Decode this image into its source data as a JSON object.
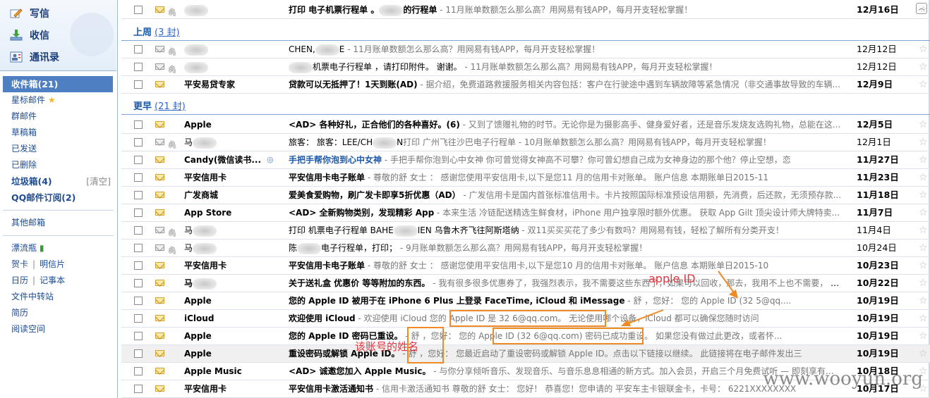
{
  "sidebar": {
    "actions": [
      {
        "label": "写信",
        "icon": "pencil-icon"
      },
      {
        "label": "收信",
        "icon": "inbox-download-icon"
      },
      {
        "label": "通讯录",
        "icon": "address-book-icon"
      }
    ],
    "inbox": "收件箱(21)",
    "starred": "星标邮件",
    "group_mail": "群邮件",
    "drafts": "草稿箱",
    "sent": "已发送",
    "deleted": "已删除",
    "junk": "垃圾箱(4)",
    "junk_clear": "[清空]",
    "subscriptions": "QQ邮件订阅(2)",
    "other": "其他邮箱",
    "drift_bottle": "漂流瓶",
    "cards": "贺卡",
    "postcards": "明信片",
    "calendar": "日历",
    "notes": "记事本",
    "file_transfer": "文件中转站",
    "resume": "简历",
    "reading": "阅读空间"
  },
  "groups": {
    "last_week": {
      "label": "上周",
      "count": "(3 封)"
    },
    "earlier": {
      "label": "更早",
      "count": "(21 封)"
    }
  },
  "emails": [
    {
      "sender": "",
      "title": "打印 电子机票行程单  。",
      "title2": "的行程单",
      "preview": " - 11月账单数额怎么那么高？用网易有钱APP，每月开支轻松掌握！",
      "date": "12月16日",
      "unread": true
    },
    {
      "sender": "",
      "title": "CHEN,",
      "title2": "E",
      "preview": " - 11月账单数额怎么那么高？用网易有钱APP，每月开支轻松掌握！",
      "date": "12月12日",
      "unread": false
    },
    {
      "sender": "",
      "title": "",
      "title2": "机票电子行程单   ，请打印附件。 谢谢。",
      "preview": " - 11月账单数额怎么那么高？用网易有钱APP，每月开支轻松掌握！",
      "date": "12月12日",
      "unread": false
    },
    {
      "sender": "平安易贷专家",
      "title": "贷款可以无抵押了！1天到账(AD)",
      "title2": "",
      "preview": " - 据介绍，免费道路救援服务相关内容包括：客户在行驶途中遇到车辆故障等紧急情况（非交通事故导致的车辆...",
      "date": "12月9日",
      "unread": true
    },
    {
      "sender": "Apple",
      "title": "<AD> 各种好礼，正合他们的各种喜好。(6)",
      "title2": "",
      "preview": " - 又到了馈赠礼物的时节。无论你是为摄影高手、健身爱好者，还是音乐发烧友选购礼物，总能在这...",
      "date": "12月5日",
      "unread": true
    },
    {
      "sender": "马",
      "title": "旅客：  旅客：LEE/CH",
      "title2": "N",
      "preview": "打印 广州飞往沙巴电子行程单 - 10月账单数额怎么那么高？用网易有钱APP，每月开支轻松掌握！",
      "date": "12月1日",
      "unread": false
    },
    {
      "sender": "Candy(微信读书...",
      "title": "手把手帮你泡到心中女神",
      "title2": "",
      "preview": " - 手把手帮你泡到心中女神 你可曾觉得女神高不可攀？你可曾幻想自己成为女神身边的那个他？停止空想，恋",
      "date": "11月27日",
      "unread": true
    },
    {
      "sender": "平安信用卡",
      "title": "平安信用卡电子账单",
      "title2": "",
      "preview": " - 尊敬的舒   女士 ： 感谢您使用平安信用卡,以下是您11 月的信用卡对账单。 账户信息 本期账单日2015-11",
      "date": "11月23日",
      "unread": true
    },
    {
      "sender": "广发商城",
      "title": "爱美食爱购物，刷广发卡即享5折优惠（AD）",
      "title2": "",
      "preview": " - 广发信用卡是国内首张标准信用卡。卡片按照国际标准预设信用额，先消费，后还款，无须预存款...",
      "date": "11月18日",
      "unread": true
    },
    {
      "sender": "App Store",
      "title": "<AD> 全新购物类别，发现精彩 App",
      "title2": "",
      "preview": " - 本来生活 冷链配送精选生鲜食材，iPhone 用户独享限时额外优惠。 获取 App Gilt 顶尖设计师大牌特卖...",
      "date": "11月7日",
      "unread": true
    },
    {
      "sender": "马",
      "title": "打印 机票电子行程单     BAHE",
      "title2": "IEN 乌鲁木齐飞往阿斯塔纳",
      "preview": " - 双11买买买花了多少有数吗？用网易有钱，轻松了解所有分类开支！",
      "date": "11月4日",
      "unread": false
    },
    {
      "sender": "马",
      "title": "陈",
      "title2": "电子行程单，打印；",
      "preview": " - 9月账单数额怎么那么高？用网易有钱APP，每月开支轻松掌握！",
      "date": "10月24日",
      "unread": false
    },
    {
      "sender": "平安信用卡",
      "title": "平安信用卡电子账单",
      "title2": "",
      "preview": " - 尊敬的舒   女士 ： 感谢您使用平安信用卡,以下是您10 月的信用卡对账单。 账户信息 本期账单日2015-10",
      "date": "10月23日",
      "unread": true
    },
    {
      "sender": "马",
      "title": "关于送礼盒 优惠价 等等附加的东西。",
      "title2": "",
      "preview": " - 我有很多很多优惠券了，我强烈表示，我不需要这些东西了，如果可以回收，那去，我用不上也不需要， 拿...",
      "date": "10月22日",
      "unread": true
    },
    {
      "sender": "Apple",
      "title": "您的 Apple ID 被用于在 iPhone 6 Plus 上登录 FaceTime, iCloud 和 iMessage",
      "title2": "",
      "preview": " - 舒   ，您好： 您的 Apple ID (32          5@qq....",
      "date": "10月19日",
      "unread": true
    },
    {
      "sender": "iCloud",
      "title": "欢迎使用 iCloud",
      "title2": "",
      "preview": " - 欢迎使用 iCloud 您的 Apple ID 是 32          6@qq.com。 无论使用哪个设备，iCloud 都可以确保您随时访问",
      "date": "10月19日",
      "unread": true
    },
    {
      "sender": "Apple",
      "title": "您的 Apple ID 密码已重设。",
      "title2": "",
      "preview": " - 舒    ，您好： 您的 Apple ID (32          6@qq.com) 密码已成功重设。 如果您没有做过此更改，或者怀...",
      "date": "10月19日",
      "unread": true
    },
    {
      "sender": "Apple",
      "title": "重设密码或解锁 Apple ID。",
      "title2": "",
      "preview": " - 舒    ，您好： 您最近启动了重设密码或解锁 Apple ID。点击以下链接以继续。 此链接将在电子邮件发出三",
      "date": "10月19日",
      "unread": true
    },
    {
      "sender": "Apple Music",
      "title": "<AD> 诚邀您加入 Apple Music。",
      "title2": "",
      "preview": " - 与你分享倾听音乐、发现音乐、与音乐息息相通的新方式。加入会员，开启三个月免费试听 — 即刻享有...",
      "date": "10月18日",
      "unread": true
    },
    {
      "sender": "平安信用卡",
      "title": "平安信用卡激活通知书",
      "title2": "",
      "preview": " - 信用卡激活通知书 尊敬的舒   女士： 您好！ 恭喜您！您申请的 平安车主卡银联金卡，卡号： 6221XXXXXXXX",
      "date": "10月17日",
      "unread": true
    }
  ],
  "annotations": {
    "apple_id_label": "apple ID",
    "name_label": "该账号的姓名"
  },
  "watermark": "www.wooyun.org",
  "colors": {
    "accent": "#4f7fc3",
    "annotation_box": "#f08a24",
    "annotation_text": "#e8323c"
  }
}
